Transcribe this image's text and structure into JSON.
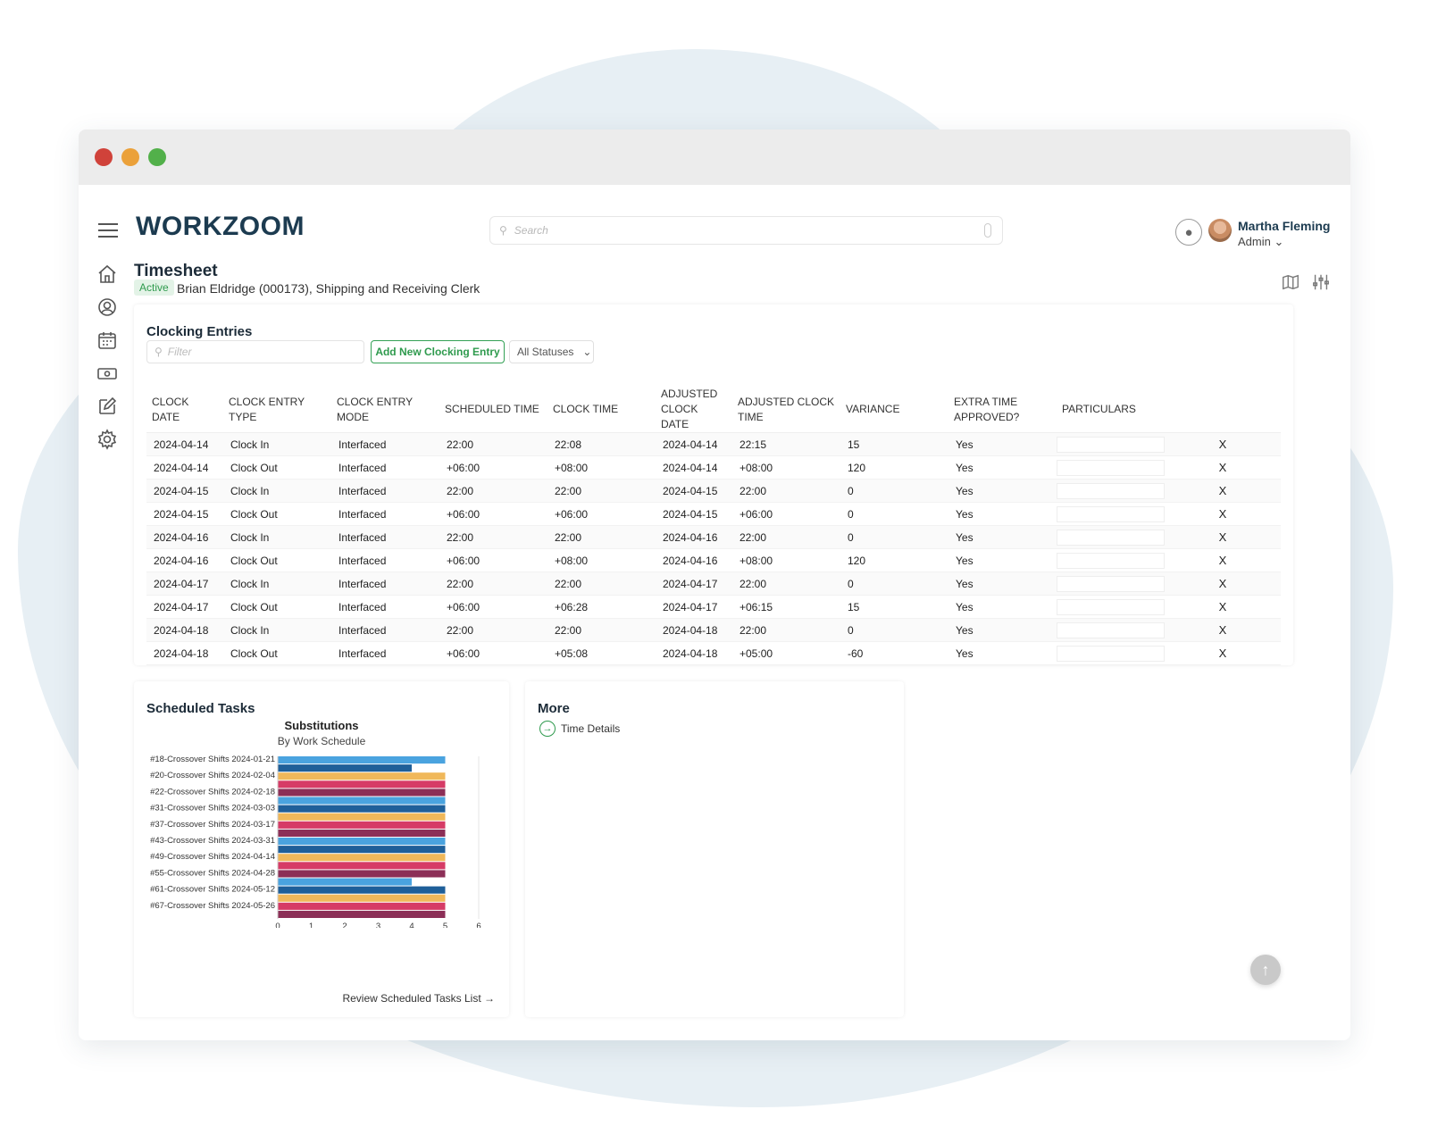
{
  "app": {
    "logo_text": "WORKZOOM"
  },
  "header": {
    "search_placeholder": "Search",
    "user": {
      "name": "Martha Fleming",
      "role": "Admin"
    }
  },
  "page": {
    "title": "Timesheet",
    "status_badge": "Active",
    "subtitle": "Brian Eldridge (000173), Shipping and Receiving Clerk"
  },
  "clocking": {
    "title": "Clocking Entries",
    "filter_placeholder": "Filter",
    "add_button": "Add New Clocking Entry",
    "status_filter": "All Statuses",
    "columns": [
      "CLOCK DATE",
      "CLOCK ENTRY TYPE",
      "CLOCK ENTRY MODE",
      "SCHEDULED TIME",
      "CLOCK TIME",
      "ADJUSTED CLOCK DATE",
      "ADJUSTED CLOCK TIME",
      "VARIANCE",
      "EXTRA TIME APPROVED?",
      "PARTICULARS"
    ],
    "delete_label": "X",
    "rows": [
      [
        "2024-04-14",
        "Clock In",
        "Interfaced",
        "22:00",
        "22:08",
        "2024-04-14",
        "22:15",
        "15",
        "Yes",
        ""
      ],
      [
        "2024-04-14",
        "Clock Out",
        "Interfaced",
        "+06:00",
        "+08:00",
        "2024-04-14",
        "+08:00",
        "120",
        "Yes",
        ""
      ],
      [
        "2024-04-15",
        "Clock In",
        "Interfaced",
        "22:00",
        "22:00",
        "2024-04-15",
        "22:00",
        "0",
        "Yes",
        ""
      ],
      [
        "2024-04-15",
        "Clock Out",
        "Interfaced",
        "+06:00",
        "+06:00",
        "2024-04-15",
        "+06:00",
        "0",
        "Yes",
        ""
      ],
      [
        "2024-04-16",
        "Clock In",
        "Interfaced",
        "22:00",
        "22:00",
        "2024-04-16",
        "22:00",
        "0",
        "Yes",
        ""
      ],
      [
        "2024-04-16",
        "Clock Out",
        "Interfaced",
        "+06:00",
        "+08:00",
        "2024-04-16",
        "+08:00",
        "120",
        "Yes",
        ""
      ],
      [
        "2024-04-17",
        "Clock In",
        "Interfaced",
        "22:00",
        "22:00",
        "2024-04-17",
        "22:00",
        "0",
        "Yes",
        ""
      ],
      [
        "2024-04-17",
        "Clock Out",
        "Interfaced",
        "+06:00",
        "+06:28",
        "2024-04-17",
        "+06:15",
        "15",
        "Yes",
        ""
      ],
      [
        "2024-04-18",
        "Clock In",
        "Interfaced",
        "22:00",
        "22:00",
        "2024-04-18",
        "22:00",
        "0",
        "Yes",
        ""
      ],
      [
        "2024-04-18",
        "Clock Out",
        "Interfaced",
        "+06:00",
        "+05:08",
        "2024-04-18",
        "+05:00",
        "-60",
        "Yes",
        ""
      ]
    ]
  },
  "tasks": {
    "title": "Scheduled Tasks",
    "review_link": "Review Scheduled Tasks List →"
  },
  "chart_data": {
    "type": "bar",
    "orientation": "horizontal",
    "title": "Substitutions",
    "subtitle": "By Work Schedule",
    "xlim": [
      0,
      6
    ],
    "xticks": [
      0,
      1,
      2,
      3,
      4,
      5,
      6
    ],
    "categories": [
      "#18-Crossover Shifts 2024-01-21",
      "#20-Crossover Shifts 2024-02-04",
      "#22-Crossover Shifts 2024-02-18",
      "#31-Crossover Shifts 2024-03-03",
      "#37-Crossover Shifts 2024-03-17",
      "#43-Crossover Shifts 2024-03-31",
      "#49-Crossover Shifts 2024-04-14",
      "#55-Crossover Shifts 2024-04-28",
      "#61-Crossover Shifts 2024-05-12",
      "#67-Crossover Shifts 2024-05-26"
    ],
    "series_colors": [
      "#4aa3df",
      "#1f5f99",
      "#f0b85a",
      "#d63b66",
      "#8c2f57"
    ],
    "bars": [
      [
        5,
        4
      ],
      [
        5,
        5
      ],
      [
        5,
        5
      ],
      [
        5,
        5
      ],
      [
        5,
        5
      ],
      [
        5,
        5
      ],
      [
        5,
        5
      ],
      [
        5,
        4
      ],
      [
        5,
        5
      ],
      [
        5,
        5
      ]
    ]
  },
  "more": {
    "title": "More",
    "time_details": "Time Details"
  }
}
